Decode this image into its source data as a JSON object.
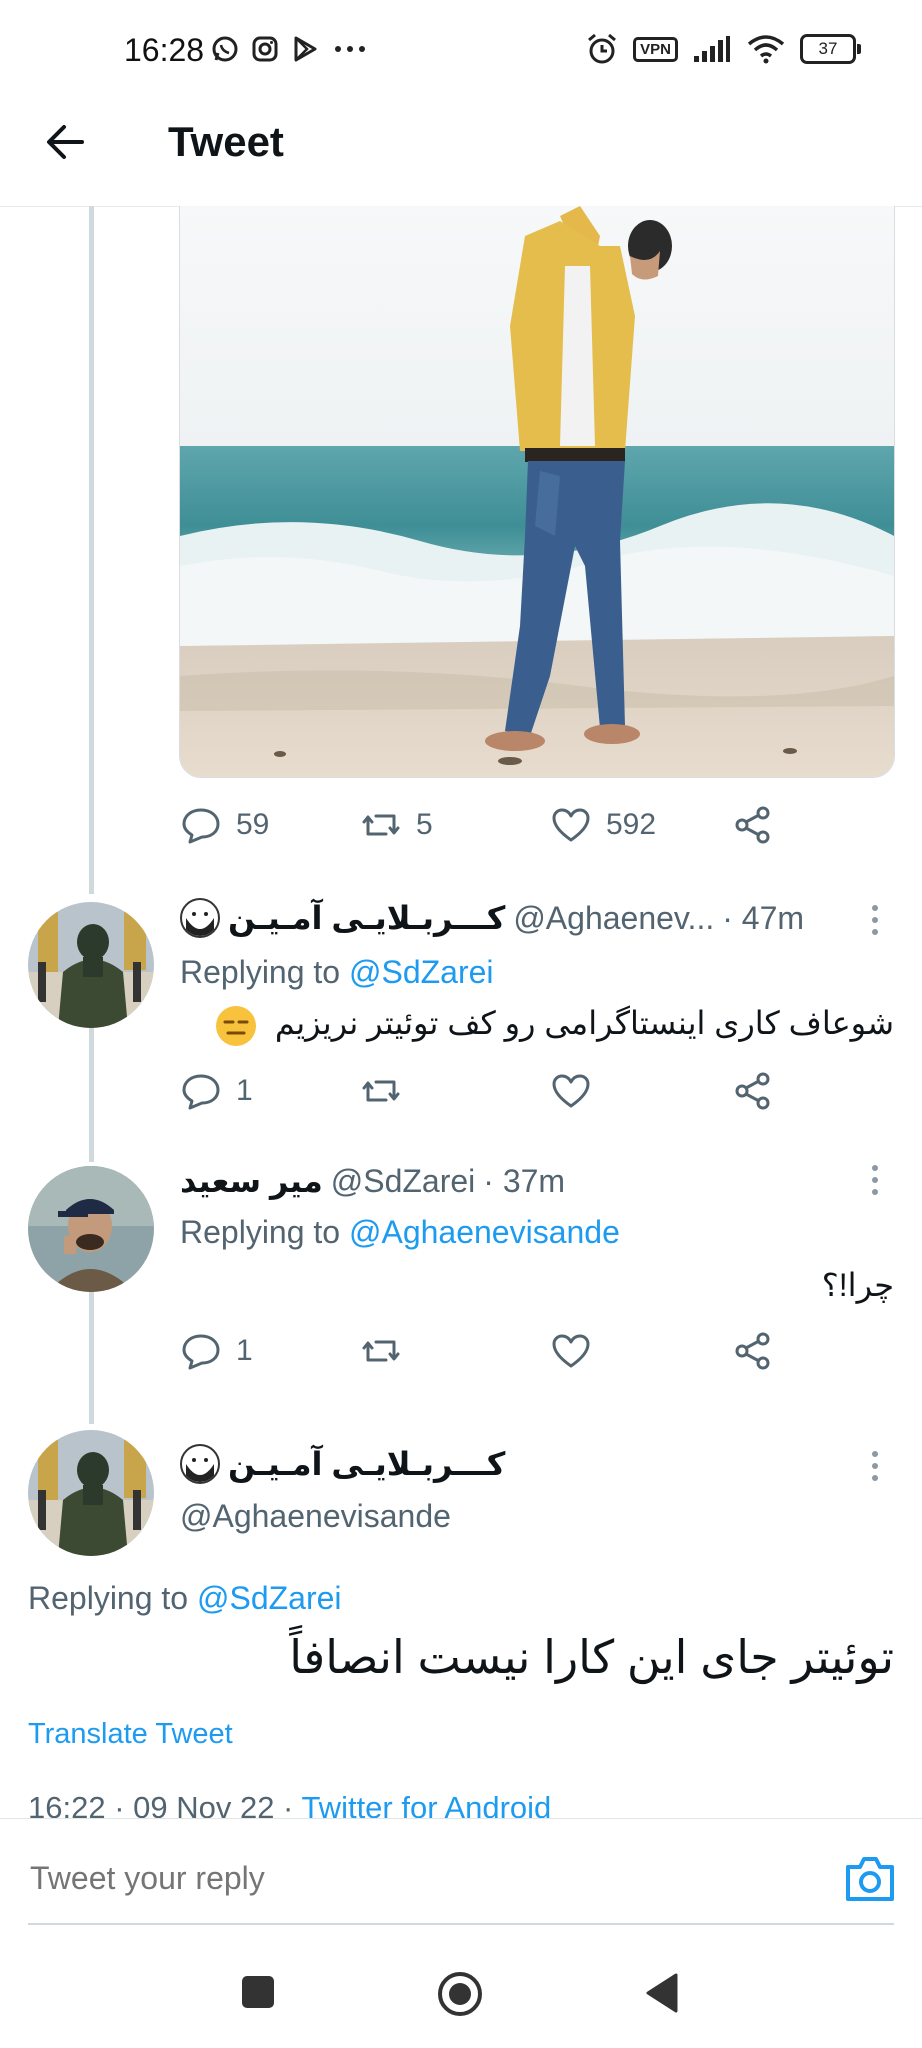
{
  "status_bar": {
    "time": "16:28",
    "vpn": "VPN",
    "battery": "37"
  },
  "header": {
    "title": "Tweet"
  },
  "first_tweet_actions": {
    "replies": "59",
    "retweets": "5",
    "likes": "592"
  },
  "replies": [
    {
      "display_name": "کـــربـلایـی آمـیـن",
      "handle": "@Aghaenev...",
      "time": "· 47m",
      "replying_label": "Replying to",
      "replying_to": "@SdZarei",
      "text": "شوعاف کاری اینستاگرامی رو کف توئیتر نریزیم",
      "reply_count": "1"
    },
    {
      "display_name": "میر سعید",
      "handle": "@SdZarei",
      "time": "· 37m",
      "replying_label": "Replying to",
      "replying_to": "@Aghaenevisande",
      "text": "چرا!؟",
      "reply_count": "1"
    }
  ],
  "focused_tweet": {
    "display_name": "کـــربـلایـی آمـیـن",
    "handle": "@Aghaenevisande",
    "replying_label": "Replying to",
    "replying_to": "@SdZarei",
    "text": "توئیتر جای این کارا نیست انصافاً",
    "translate_label": "Translate Tweet",
    "timestamp": "16:22 · 09 Nov 22 ·",
    "source": "Twitter for Android"
  },
  "composer": {
    "placeholder": "Tweet your reply"
  },
  "colors": {
    "accent": "#1d9bf0",
    "secondary_text": "#536471",
    "thread_line": "#cfd9de"
  }
}
